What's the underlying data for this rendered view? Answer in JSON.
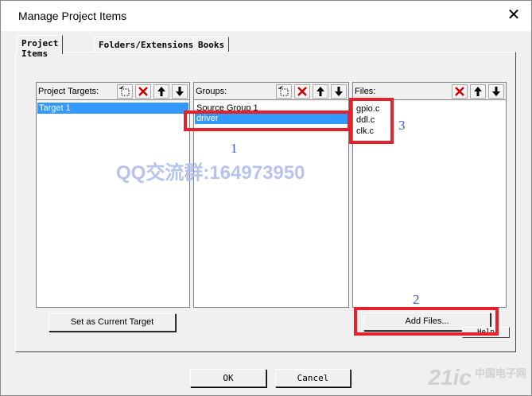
{
  "window": {
    "title": "Manage Project Items",
    "close_glyph": "✕"
  },
  "tabs": [
    {
      "label": "Project Items",
      "active": true
    },
    {
      "label": "Folders/Extensions",
      "active": false
    },
    {
      "label": "Books",
      "active": false
    }
  ],
  "panes": {
    "targets": {
      "label": "Project Targets:",
      "items": [
        {
          "text": "Target 1",
          "selected": true
        }
      ]
    },
    "groups": {
      "label": "Groups:",
      "items": [
        {
          "text": "Source Group 1",
          "selected": false
        },
        {
          "text": "driver",
          "selected": true
        }
      ]
    },
    "files": {
      "label": "Files:",
      "items": [
        {
          "text": "gpio.c"
        },
        {
          "text": "ddl.c"
        },
        {
          "text": "clk.c"
        }
      ]
    }
  },
  "toolbar_icons": {
    "new": "new-item-icon",
    "delete": "delete-x-icon",
    "up": "move-up-arrow-icon",
    "down": "move-down-arrow-icon"
  },
  "buttons": {
    "set_current_target": "Set as Current Target",
    "add_files": "Add Files...",
    "help": "Help",
    "ok": "OK",
    "cancel": "Cancel"
  },
  "annotations": {
    "one": "1",
    "two": "2",
    "three": "3"
  },
  "overlay": {
    "watermark": "QQ交流群:164973950",
    "logo": "21ic",
    "logo_sub": "中国电子网"
  },
  "colors": {
    "selection": "#3399ff",
    "annotation_box": "#e8202a",
    "annotation_text": "#3b5fc8"
  }
}
